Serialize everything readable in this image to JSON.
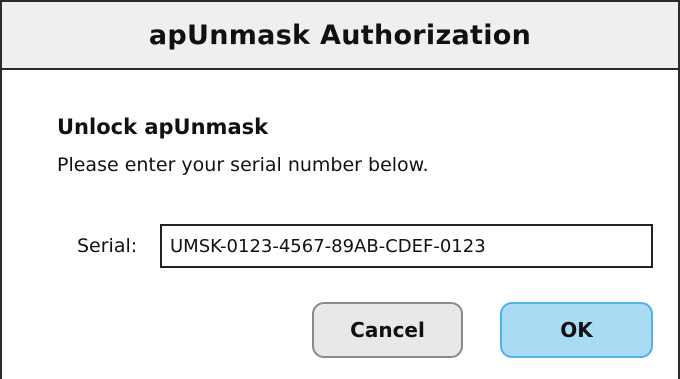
{
  "dialog": {
    "title": "apUnmask Authorization",
    "heading": "Unlock apUnmask",
    "message": "Please enter your serial number below.",
    "serial_label": "Serial:",
    "serial_value": "UMSK-0123-4567-89AB-CDEF-0123",
    "cancel_label": "Cancel",
    "ok_label": "OK"
  },
  "colors": {
    "titlebar_bg": "#efefef",
    "border": "#2a2a2a",
    "ok_button_bg": "#a9dcf4",
    "ok_button_border": "#4fb3e6",
    "cancel_button_bg": "#e8e8e8"
  }
}
